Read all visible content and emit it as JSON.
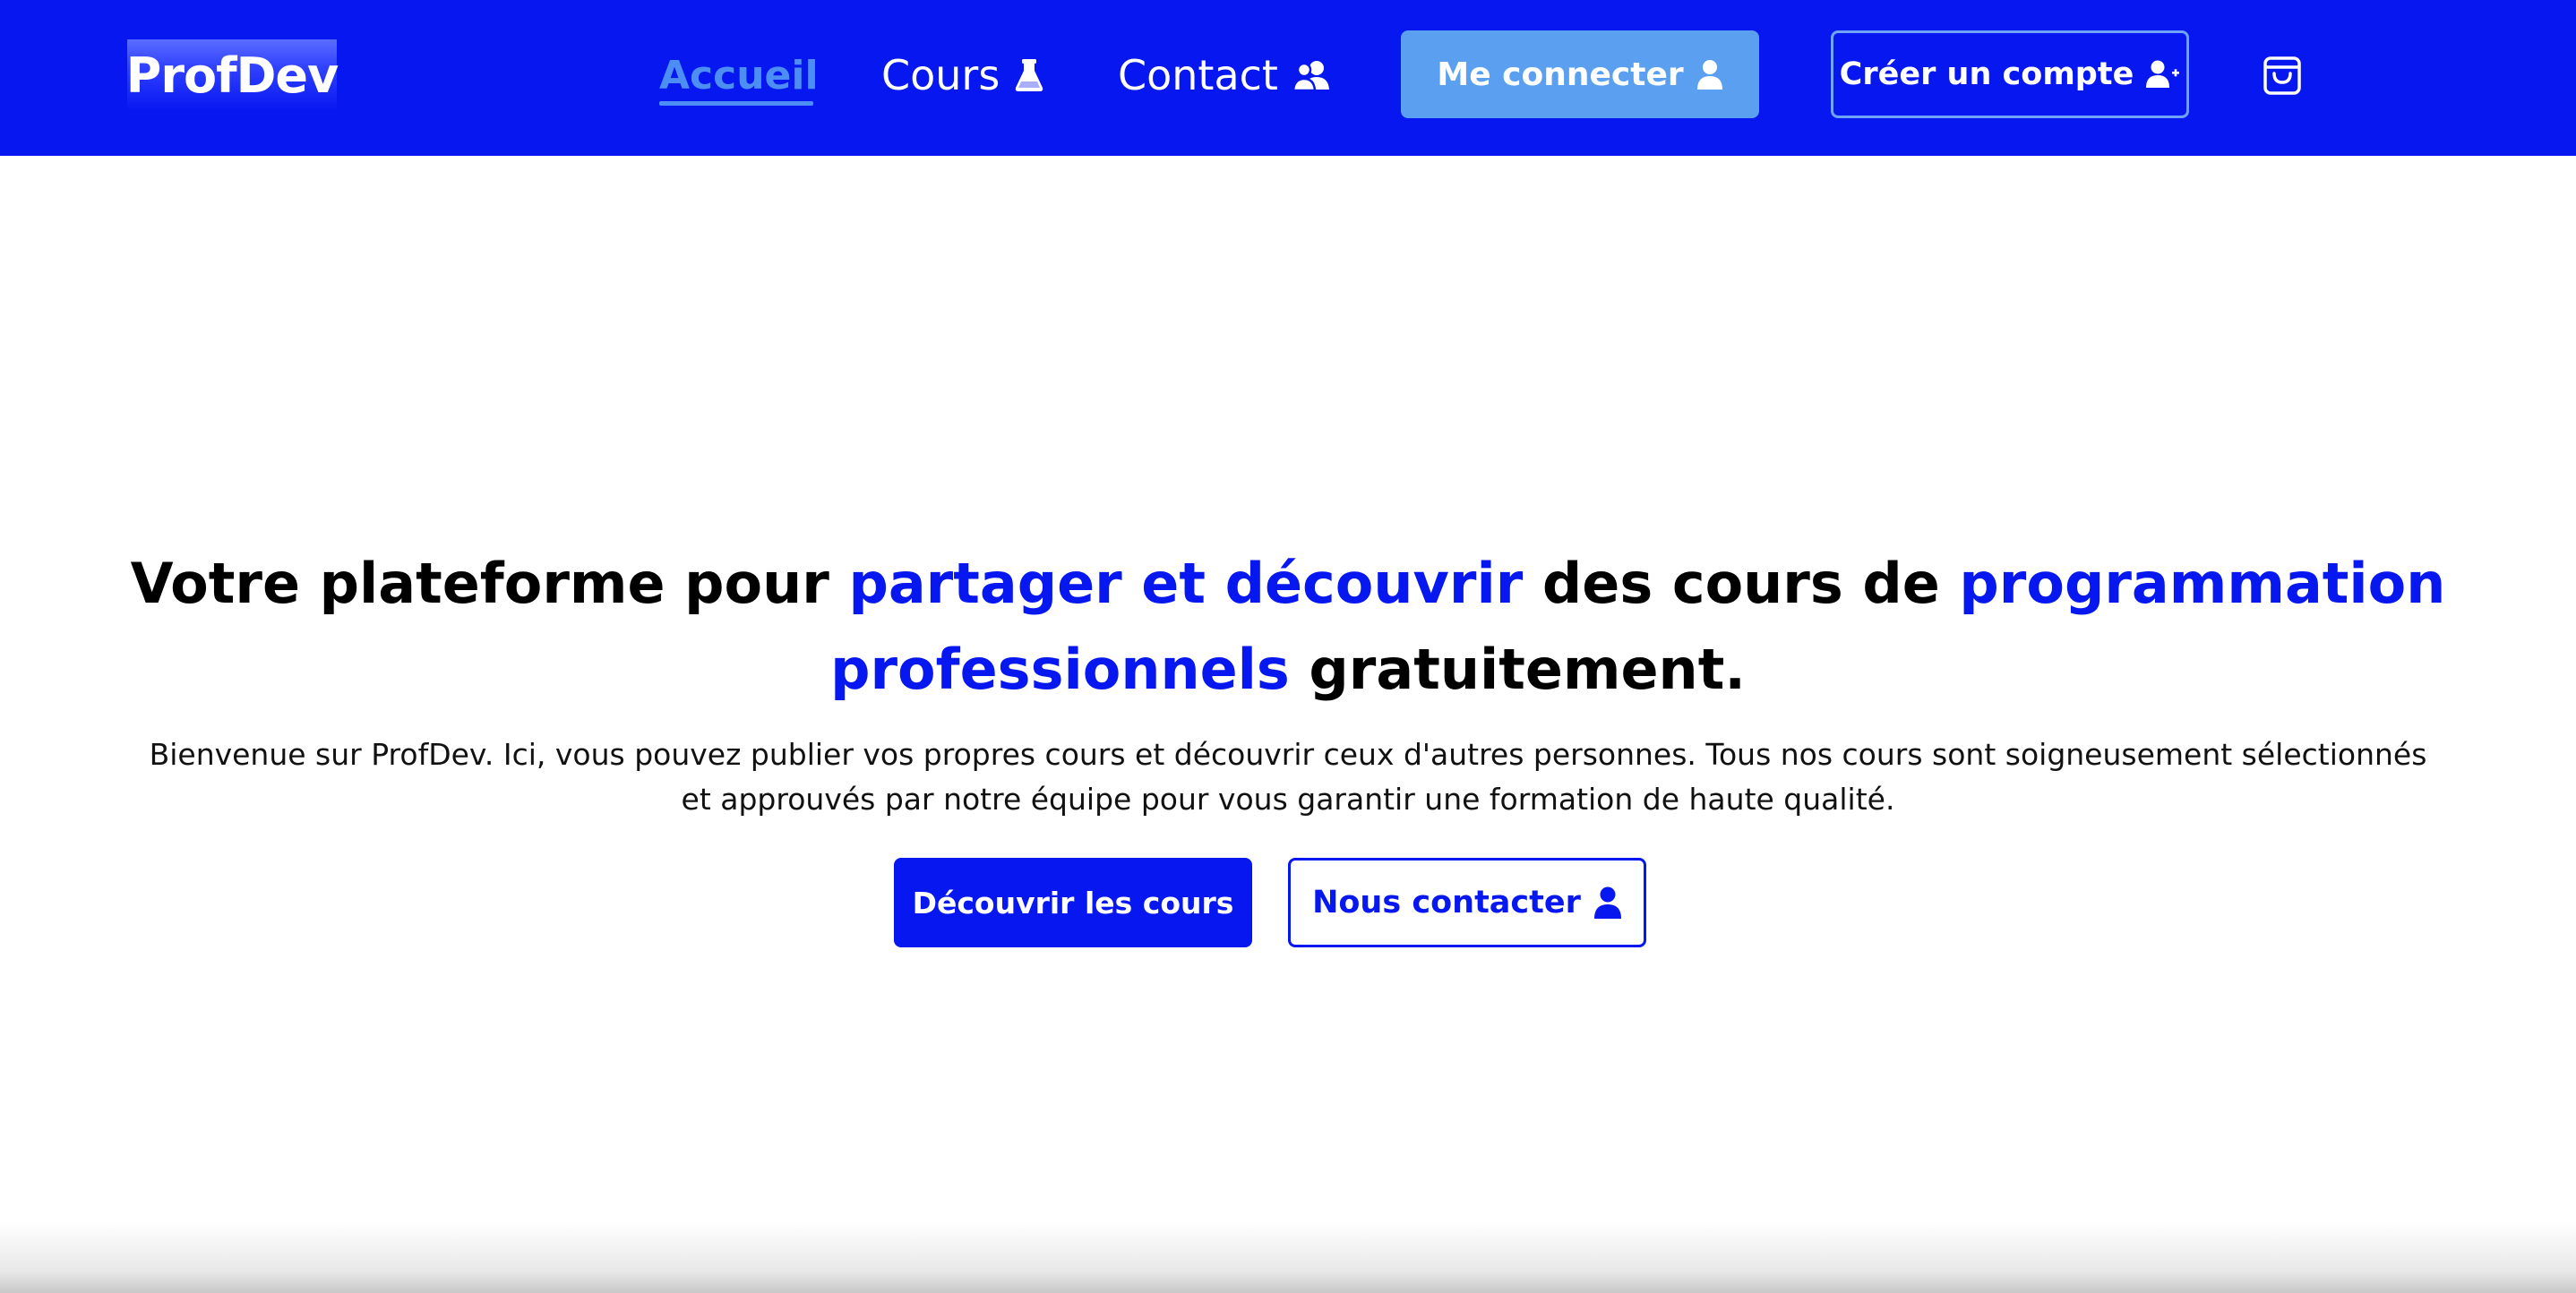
{
  "colors": {
    "brand_blue": "#0717f0",
    "active_link": "#4d8ef5",
    "login_button": "#5ba0f0",
    "text_dark": "#000000",
    "background": "#ffffff"
  },
  "header": {
    "logo": "ProfDev",
    "nav": [
      {
        "label": "Accueil",
        "icon": null,
        "active": true
      },
      {
        "label": "Cours",
        "icon": "flask-icon",
        "active": false
      },
      {
        "label": "Contact",
        "icon": "users-icon",
        "active": false
      }
    ],
    "login_label": "Me connecter",
    "login_icon": "user-icon",
    "register_label": "Créer un compte",
    "register_icon": "user-plus-icon",
    "cart_icon": "shopping-bag-icon"
  },
  "hero": {
    "title_parts": [
      {
        "text": "Votre plateforme pour ",
        "highlight": false
      },
      {
        "text": "partager et découvrir",
        "highlight": true
      },
      {
        "text": " des cours de ",
        "highlight": false
      },
      {
        "text": "programmation professionnels",
        "highlight": true
      },
      {
        "text": " gratuitement.",
        "highlight": false
      }
    ],
    "subtitle": "Bienvenue sur ProfDev. Ici, vous pouvez publier vos propres cours et découvrir ceux d'autres personnes. Tous nos cours sont soigneusement sélectionnés et approuvés par notre équipe pour vous garantir une formation de haute qualité.",
    "discover_button": "Découvrir les cours",
    "contact_button": "Nous contacter",
    "contact_icon": "user-icon"
  }
}
